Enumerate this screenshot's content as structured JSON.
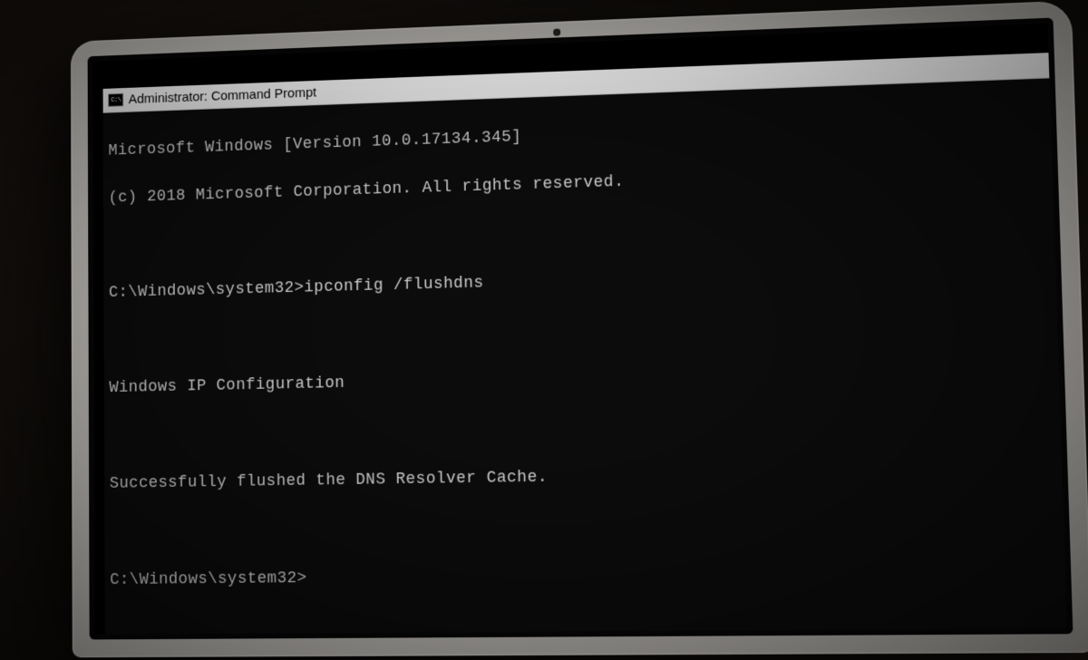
{
  "window": {
    "icon_text": "C:\\",
    "title": "Administrator: Command Prompt"
  },
  "terminal": {
    "lines": [
      "Microsoft Windows [Version 10.0.17134.345]",
      "(c) 2018 Microsoft Corporation. All rights reserved."
    ],
    "prompt1": "C:\\Windows\\system32>",
    "command1": "ipconfig /flushdns",
    "output_header": "Windows IP Configuration",
    "output_result": "Successfully flushed the DNS Resolver Cache.",
    "prompt2": "C:\\Windows\\system32>"
  }
}
